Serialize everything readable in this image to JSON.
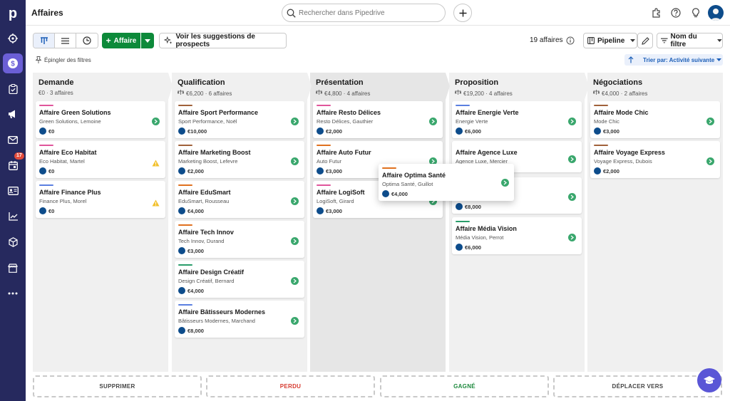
{
  "sidebar": {
    "logo_letter": "p",
    "badge": "17"
  },
  "topbar": {
    "title": "Affaires",
    "search_placeholder": "Rechercher dans Pipedrive"
  },
  "toolbar": {
    "add_label": "Affaire",
    "suggest_label": "Voir les suggestions de prospects",
    "deal_count": "19 affaires",
    "pipeline_label": "Pipeline",
    "filter_label": "Nom du filtre",
    "pin_label": "Épingler des filtres",
    "sort_label": "Trier par: Activité suivante"
  },
  "columns": [
    {
      "name": "Demande",
      "meta": "€0 · 3 affaires"
    },
    {
      "name": "Qualification",
      "meta": "€6,200 · 6 affaires"
    },
    {
      "name": "Présentation",
      "meta": "€4,800 · 4 affaires"
    },
    {
      "name": "Proposition",
      "meta": "€19,200 · 4 affaires"
    },
    {
      "name": "Négociations",
      "meta": "€4,000 · 2 affaires"
    }
  ],
  "cards": [
    [
      {
        "title": "Affaire Green Solutions",
        "sub": "Green Solutions, Lemoine",
        "value": "€0",
        "color": "#e0559b",
        "status": "go"
      },
      {
        "title": "Affaire Eco Habitat",
        "sub": "Eco Habitat, Martel",
        "value": "€0",
        "color": "#e0559b",
        "status": "warn"
      },
      {
        "title": "Affaire Finance Plus",
        "sub": "Finance Plus, Morel",
        "value": "€0",
        "color": "#5a7fe0",
        "status": "warn"
      }
    ],
    [
      {
        "title": "Affaire Sport Performance",
        "sub": "Sport Performance, Noël",
        "value": "€10,000",
        "color": "#a0613a",
        "status": "go"
      },
      {
        "title": "Affaire Marketing Boost",
        "sub": "Marketing Boost, Lefevre",
        "value": "€2,000",
        "color": "#a0613a",
        "status": "go"
      },
      {
        "title": "Affaire EduSmart",
        "sub": "EduSmart, Rousseau",
        "value": "€4,000",
        "color": "#e0711f",
        "status": "go"
      },
      {
        "title": "Affaire Tech Innov",
        "sub": "Tech Innov, Durand",
        "value": "€3,000",
        "color": "#e0711f",
        "status": "go"
      },
      {
        "title": "Affaire Design Créatif",
        "sub": "Design Créatif, Bernard",
        "value": "€4,000",
        "color": "#2a9d6a",
        "status": "go"
      },
      {
        "title": "Affaire Bâtisseurs Modernes",
        "sub": "Bâtisseurs Modernes, Marchand",
        "value": "€8,000",
        "color": "#5a7fe0",
        "status": "go"
      }
    ],
    [
      {
        "title": "Affaire Resto Délices",
        "sub": "Resto Délices, Gauthier",
        "value": "€2,000",
        "color": "#e0559b",
        "status": "go"
      },
      {
        "title": "Affaire Auto Futur",
        "sub": "Auto Futur",
        "value": "€3,000",
        "color": "#e0711f",
        "status": "go"
      },
      {
        "title": "Affaire LogiSoft",
        "sub": "LogiSoft, Girard",
        "value": "€3,000",
        "color": "#e0559b",
        "status": "go"
      }
    ],
    [
      {
        "title": "Affaire Energie Verte",
        "sub": "Energie Verte",
        "value": "€6,000",
        "color": "#5a7fe0",
        "status": "go"
      },
      {
        "title": "Affaire Agence Luxe",
        "sub": "Agence Luxe, Mercier",
        "value": "",
        "color": "",
        "status": "go"
      },
      {
        "title": "",
        "sub": "",
        "value": "€8,000",
        "color": "",
        "status": "go"
      },
      {
        "title": "Affaire Média Vision",
        "sub": "Média Vision, Perrot",
        "value": "€6,000",
        "color": "#2a9d6a",
        "status": "go"
      }
    ],
    [
      {
        "title": "Affaire Mode Chic",
        "sub": "Mode Chic",
        "value": "€3,000",
        "color": "#a0613a",
        "status": "go"
      },
      {
        "title": "Affaire Voyage Express",
        "sub": "Voyage Express, Dubois",
        "value": "€2,000",
        "color": "#a0613a",
        "status": "go"
      }
    ]
  ],
  "drag_card": {
    "title": "Affaire Optima Santé",
    "sub": "Optima Santé, Guillot",
    "value": "€4,000",
    "color": "#e0711f"
  },
  "drop_zones": [
    {
      "label": "SUPPRIMER",
      "color": "#444444"
    },
    {
      "label": "PERDU",
      "color": "#d63a2f"
    },
    {
      "label": "GAGNÉ",
      "color": "#1e8a3e"
    },
    {
      "label": "DÉPLACER VERS",
      "color": "#444444"
    }
  ]
}
